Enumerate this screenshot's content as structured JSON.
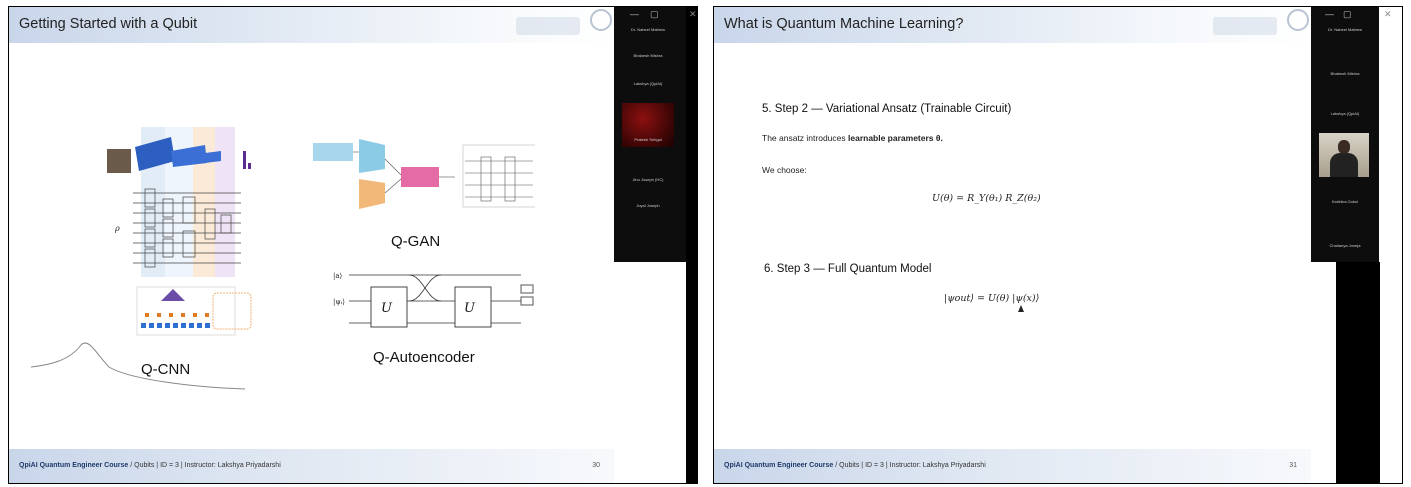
{
  "left_slide": {
    "title": "Getting Started with a Qubit",
    "labels": {
      "qcnn": "Q-CNN",
      "qgan": "Q-GAN",
      "qautoencoder": "Q-Autoencoder"
    },
    "footer_brand": "QpiAI Quantum Engineer Course",
    "footer_rest": " / Qubits | ID = 3 | Instructor: Lakshya Priyadarshi",
    "page_number": "30",
    "participants": [
      "Dr. Nabeel Mathew",
      "Bhabesh Mishra",
      "Lakshya (QpiAI)",
      "Prateek Sehgal",
      "Jinu Joseph (HC)",
      "Joyal Joseph",
      "Raghav Hariprasad",
      "Karthika Gokul",
      "Chaitanya Juneja"
    ]
  },
  "right_slide": {
    "title": "What is Quantum Machine Learning?",
    "step2_heading": "5. Step 2 — Variational Ansatz (Trainable Circuit)",
    "step2_text_plain": "The ansatz introduces ",
    "step2_text_bold": "learnable parameters θ.",
    "we_choose": "We choose:",
    "formula_ansatz": "U(θ) = R_Y(θ₁) R_Z(θ₂)",
    "step3_heading": "6. Step 3 — Full Quantum Model",
    "formula_model": "|ψout⟩ = U(θ) |ψ(x)⟩",
    "footer_brand": "QpiAI Quantum Engineer Course",
    "footer_rest": " / Qubits | ID = 3 | Instructor: Lakshya Priyadarshi",
    "page_number": "31"
  }
}
